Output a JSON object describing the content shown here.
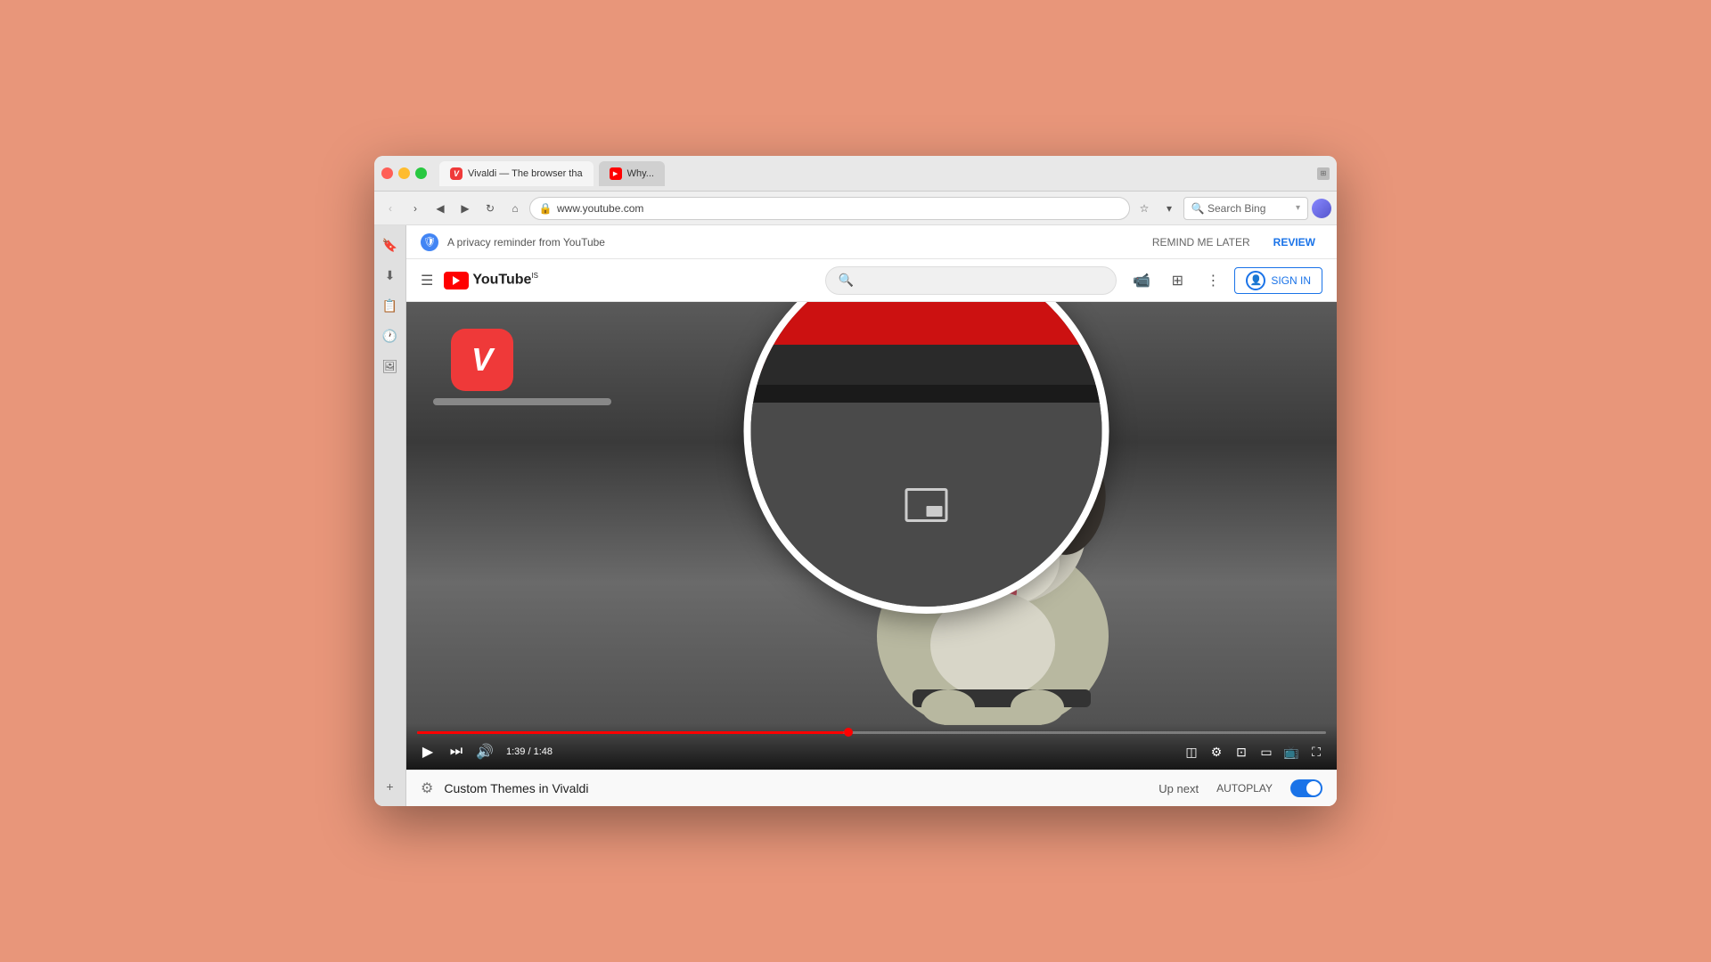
{
  "browser": {
    "title": "Vivaldi — The browser tha",
    "tab2_title": "Why...",
    "address": "www.youtube.com",
    "search_placeholder": "Search Bing"
  },
  "privacy_banner": {
    "text": "A privacy reminder from YouTube",
    "remind_later": "REMIND ME LATER",
    "review": "REVIEW"
  },
  "youtube": {
    "logo_text": "YouTube",
    "logo_sup": "IS",
    "sign_in": "SIGN IN"
  },
  "video": {
    "current_time": "1:39",
    "total_time": "1:48",
    "time_display": "1:39 / 1:48"
  },
  "below_video": {
    "title": "Custom Themes in Vivaldi",
    "up_next": "Up next",
    "autoplay": "AUTOPLAY"
  },
  "magnifier": {
    "pip_icon": "picture-in-picture"
  }
}
